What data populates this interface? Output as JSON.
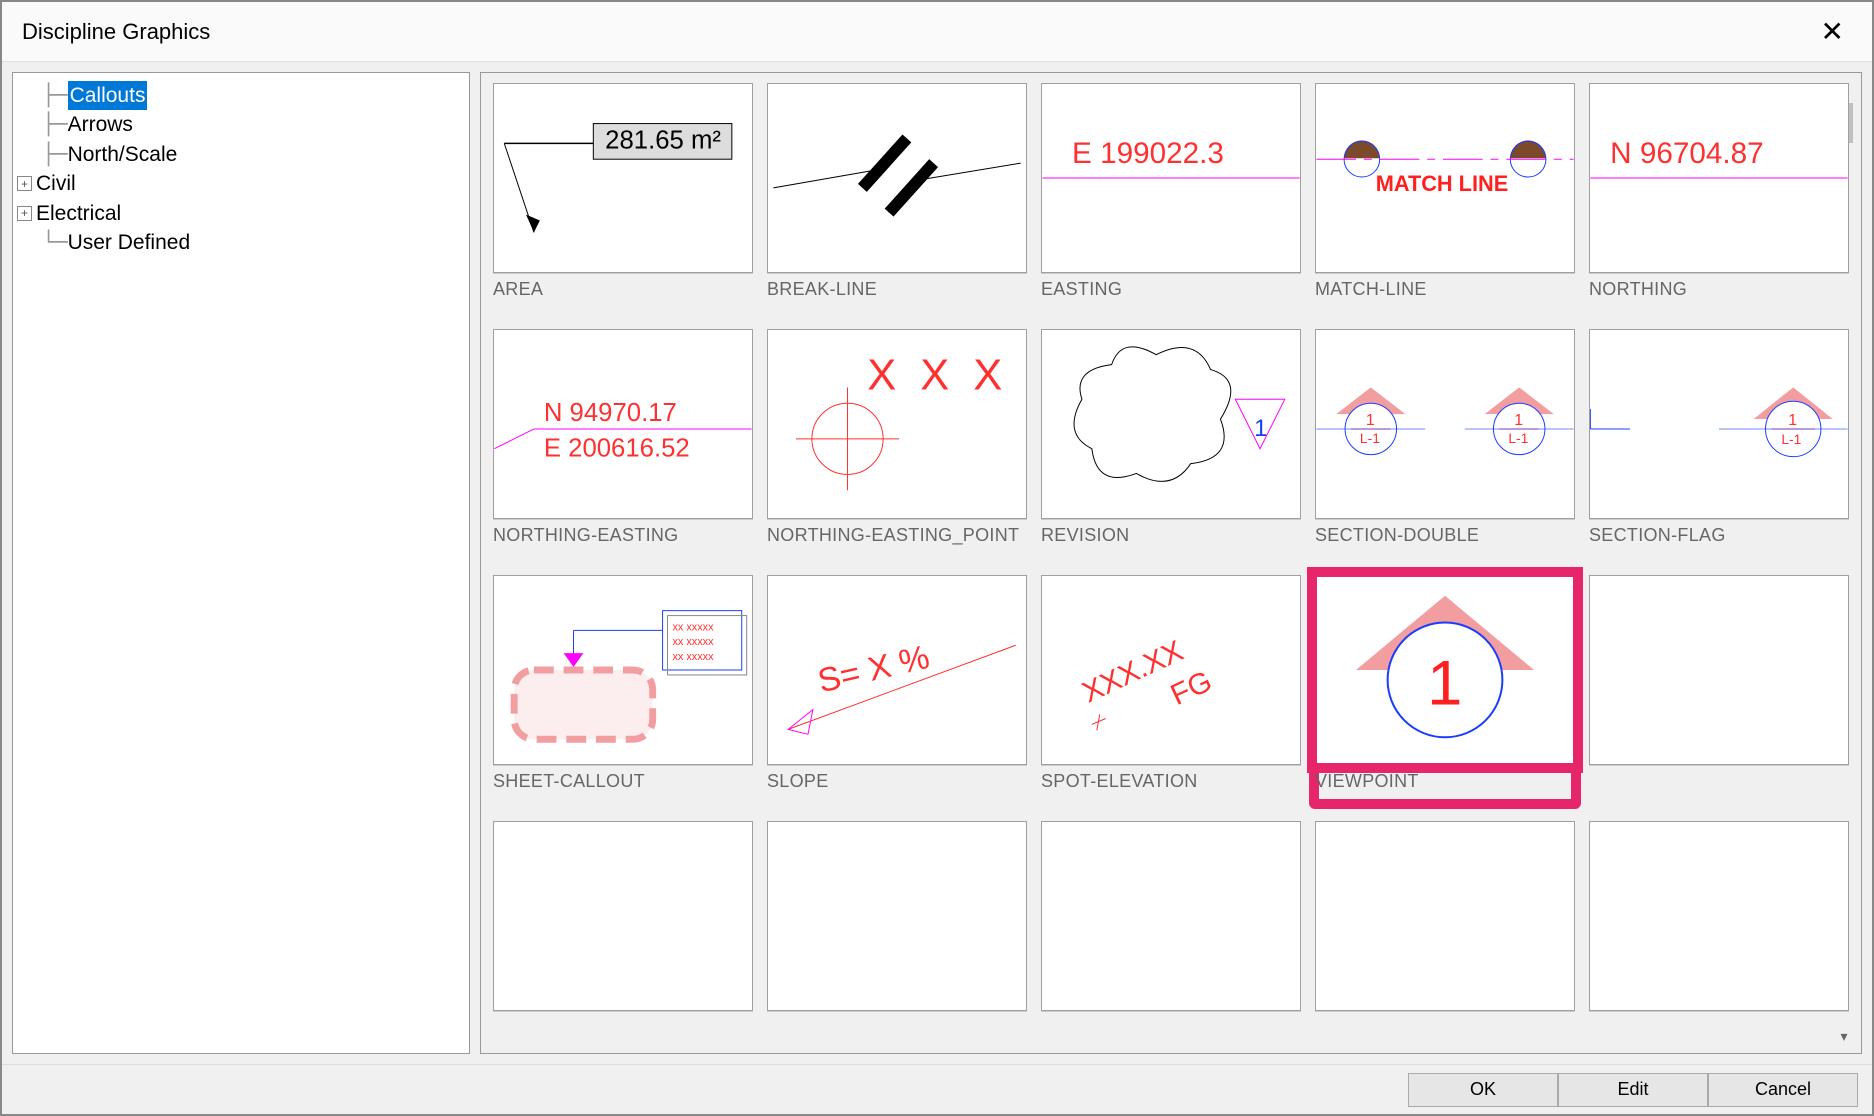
{
  "window": {
    "title": "Discipline Graphics"
  },
  "tree": {
    "items": [
      {
        "label": "Callouts",
        "selected": true,
        "expandable": false
      },
      {
        "label": "Arrows",
        "selected": false,
        "expandable": false
      },
      {
        "label": "North/Scale",
        "selected": false,
        "expandable": false
      },
      {
        "label": "Civil",
        "selected": false,
        "expandable": true
      },
      {
        "label": "Electrical",
        "selected": false,
        "expandable": true
      },
      {
        "label": "User Defined",
        "selected": false,
        "expandable": false
      }
    ]
  },
  "tiles": [
    {
      "label": "AREA",
      "preview_text": "281.65 m²"
    },
    {
      "label": "BREAK-LINE"
    },
    {
      "label": "EASTING",
      "preview_text": "E  199022.3"
    },
    {
      "label": "MATCH-LINE",
      "preview_text": "MATCH LINE"
    },
    {
      "label": "NORTHING",
      "preview_text": "N  96704.87"
    },
    {
      "label": "NORTHING-EASTING",
      "preview_text_1": "N  94970.17",
      "preview_text_2": "E  200616.52"
    },
    {
      "label": "NORTHING-EASTING_POINT",
      "preview_text": "X X X"
    },
    {
      "label": "REVISION",
      "preview_text": "1"
    },
    {
      "label": "SECTION-DOUBLE",
      "preview_text_1": "1",
      "preview_text_2": "L-1"
    },
    {
      "label": "SECTION-FLAG",
      "preview_text_1": "1",
      "preview_text_2": "L-1"
    },
    {
      "label": "SHEET-CALLOUT",
      "preview_text": "xx xxxxx"
    },
    {
      "label": "SLOPE",
      "preview_text": "S=    X %"
    },
    {
      "label": "SPOT-ELEVATION",
      "preview_text_1": "XXX.XX",
      "preview_text_2": "FG"
    },
    {
      "label": "VIEWPOINT",
      "preview_text": "1",
      "highlighted": true
    },
    {
      "label": ""
    },
    {
      "label": ""
    },
    {
      "label": ""
    },
    {
      "label": ""
    },
    {
      "label": ""
    },
    {
      "label": ""
    }
  ],
  "buttons": {
    "ok": "OK",
    "edit": "Edit",
    "cancel": "Cancel"
  },
  "colors": {
    "highlight": "#e7256a",
    "red": "#ff3030",
    "blue": "#1a3cff",
    "pink": "#f29ea1",
    "magenta": "#ff00ff"
  }
}
